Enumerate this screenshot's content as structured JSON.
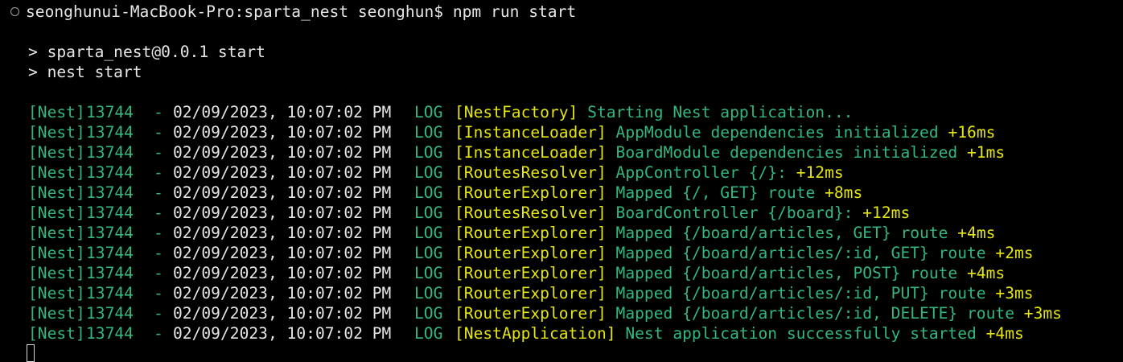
{
  "terminal": {
    "prompt": "seonghunui-MacBook-Pro:sparta_nest seonghun$",
    "command": "npm run start",
    "script_lines": [
      "> sparta_nest@0.0.1 start",
      "> nest start"
    ],
    "logs": [
      {
        "prefix": "[Nest]",
        "pid": "13744",
        "dash": "-",
        "timestamp": "02/09/2023, 10:07:02 PM",
        "level": "LOG",
        "context": "[NestFactory]",
        "message": "Starting Nest application...",
        "elapsed": ""
      },
      {
        "prefix": "[Nest]",
        "pid": "13744",
        "dash": "-",
        "timestamp": "02/09/2023, 10:07:02 PM",
        "level": "LOG",
        "context": "[InstanceLoader]",
        "message": "AppModule dependencies initialized",
        "elapsed": "+16ms"
      },
      {
        "prefix": "[Nest]",
        "pid": "13744",
        "dash": "-",
        "timestamp": "02/09/2023, 10:07:02 PM",
        "level": "LOG",
        "context": "[InstanceLoader]",
        "message": "BoardModule dependencies initialized",
        "elapsed": "+1ms"
      },
      {
        "prefix": "[Nest]",
        "pid": "13744",
        "dash": "-",
        "timestamp": "02/09/2023, 10:07:02 PM",
        "level": "LOG",
        "context": "[RoutesResolver]",
        "message": "AppController {/}:",
        "elapsed": "+12ms"
      },
      {
        "prefix": "[Nest]",
        "pid": "13744",
        "dash": "-",
        "timestamp": "02/09/2023, 10:07:02 PM",
        "level": "LOG",
        "context": "[RouterExplorer]",
        "message": "Mapped {/, GET} route",
        "elapsed": "+8ms"
      },
      {
        "prefix": "[Nest]",
        "pid": "13744",
        "dash": "-",
        "timestamp": "02/09/2023, 10:07:02 PM",
        "level": "LOG",
        "context": "[RoutesResolver]",
        "message": "BoardController {/board}:",
        "elapsed": "+12ms"
      },
      {
        "prefix": "[Nest]",
        "pid": "13744",
        "dash": "-",
        "timestamp": "02/09/2023, 10:07:02 PM",
        "level": "LOG",
        "context": "[RouterExplorer]",
        "message": "Mapped {/board/articles, GET} route",
        "elapsed": "+4ms"
      },
      {
        "prefix": "[Nest]",
        "pid": "13744",
        "dash": "-",
        "timestamp": "02/09/2023, 10:07:02 PM",
        "level": "LOG",
        "context": "[RouterExplorer]",
        "message": "Mapped {/board/articles/:id, GET} route",
        "elapsed": "+2ms"
      },
      {
        "prefix": "[Nest]",
        "pid": "13744",
        "dash": "-",
        "timestamp": "02/09/2023, 10:07:02 PM",
        "level": "LOG",
        "context": "[RouterExplorer]",
        "message": "Mapped {/board/articles, POST} route",
        "elapsed": "+4ms"
      },
      {
        "prefix": "[Nest]",
        "pid": "13744",
        "dash": "-",
        "timestamp": "02/09/2023, 10:07:02 PM",
        "level": "LOG",
        "context": "[RouterExplorer]",
        "message": "Mapped {/board/articles/:id, PUT} route",
        "elapsed": "+3ms"
      },
      {
        "prefix": "[Nest]",
        "pid": "13744",
        "dash": "-",
        "timestamp": "02/09/2023, 10:07:02 PM",
        "level": "LOG",
        "context": "[RouterExplorer]",
        "message": "Mapped {/board/articles/:id, DELETE} route",
        "elapsed": "+3ms"
      },
      {
        "prefix": "[Nest]",
        "pid": "13744",
        "dash": "-",
        "timestamp": "02/09/2023, 10:07:02 PM",
        "level": "LOG",
        "context": "[NestApplication]",
        "message": "Nest application successfully started",
        "elapsed": "+4ms"
      }
    ]
  },
  "colors": {
    "background": "#000000",
    "log_green": "#32b87e",
    "context_yellow": "#e5e510",
    "text": "#e6e6e6"
  },
  "icons": {
    "prompt_marker": "circle-outline-icon",
    "cursor": "block-cursor"
  }
}
